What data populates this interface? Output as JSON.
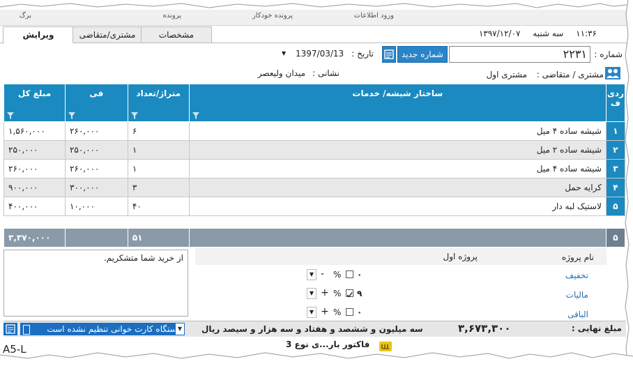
{
  "menu": {
    "items": [
      "برگ",
      "پرونده",
      "پرونده خودکار",
      "ورود اطلاعات"
    ]
  },
  "tabs": [
    {
      "label": "ویرایش"
    },
    {
      "label": "مشتری/متقاضی"
    },
    {
      "label": "مشخصات"
    }
  ],
  "datetime": {
    "time": "۱۱:۳۶",
    "weekday": "سه شنبه",
    "date": "۱۳۹۷/۱۲/۰۷"
  },
  "header": {
    "number_label": "شماره :",
    "number_value": "۲۲۳۱",
    "new_number_button": "شماره جدید",
    "date_label": "تاریخ :",
    "date_value": "1397/03/13",
    "customer_label": "مشتری / متقاضی :",
    "customer_value": "مشتری اول",
    "address_label": "نشانی :",
    "address_value": "میدان ولیعصر"
  },
  "table": {
    "columns": [
      "ردی ف",
      "ساختار شیشه/ خدمات",
      "متراژ/تعداد",
      "فی",
      "مبلغ کل"
    ],
    "rows": [
      {
        "no": "۱",
        "service": "شیشه ساده ۴ میل",
        "qty": "۶",
        "price": "۲۶۰,۰۰۰",
        "total": "۱,۵۶۰,۰۰۰"
      },
      {
        "no": "۲",
        "service": "شیشه ساده ۲ میل",
        "qty": "۱",
        "price": "۲۵۰,۰۰۰",
        "total": "۲۵۰,۰۰۰"
      },
      {
        "no": "۳",
        "service": "شیشه ساده ۴ میل",
        "qty": "۱",
        "price": "۲۶۰,۰۰۰",
        "total": "۲۶۰,۰۰۰"
      },
      {
        "no": "۴",
        "service": "کرایه حمل",
        "qty": "۳",
        "price": "۳۰۰,۰۰۰",
        "total": "۹۰۰,۰۰۰"
      },
      {
        "no": "۵",
        "service": "لاستیک لبه دار",
        "qty": "۴۰",
        "price": "۱۰,۰۰۰",
        "total": "۴۰۰,۰۰۰"
      }
    ],
    "summary": {
      "count": "۵",
      "qty_total": "۵۱",
      "amount_total": "۳,۳۷۰,۰۰۰"
    }
  },
  "notes": {
    "text": "از خرید شما متشکریم."
  },
  "project": {
    "label": "نام پروژه",
    "value": "پروژه اول",
    "discount_label": "تخفیف",
    "tax_label": "مالیات",
    "remaining_label": "الباقی",
    "discount_value": "۰",
    "tax_value": "۹",
    "remaining_value": "۰",
    "percent_sign": "%",
    "minus": "-",
    "plus": "+"
  },
  "status": {
    "final_label": "مبلغ نهایی :",
    "final_value": "۳,۶۷۳,۳۰۰",
    "final_words": "سه میلیون و ششصد و هفتاد و سه هزار و سیصد ریال",
    "reader_text": "دستگاه کارت خوانی تنظیم نشده است"
  },
  "footer": {
    "left_text": "A5-L",
    "invoice_type": "فاکتور بار...ی نوع 3"
  },
  "colors": {
    "accent": "#1b8ac0",
    "button": "#2a84c8",
    "link": "#2a6fb0"
  }
}
